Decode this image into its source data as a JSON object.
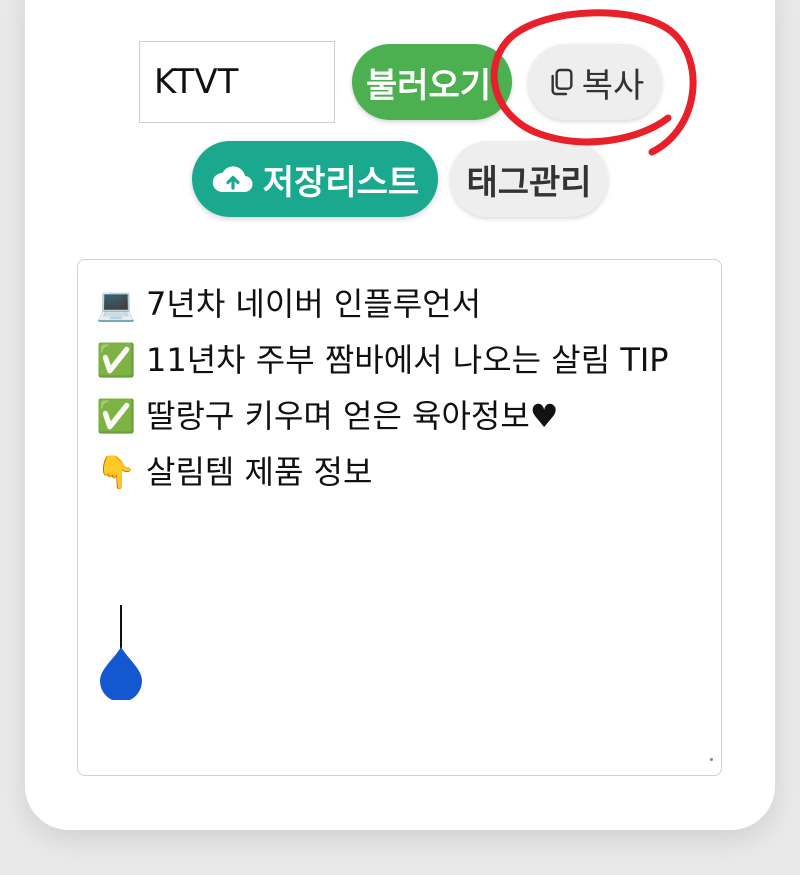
{
  "code_input": {
    "value": "KTVT"
  },
  "buttons": {
    "load_label": "불러오기",
    "copy_label": "복사",
    "save_list_label": "저장리스트",
    "tag_manage_label": "태그관리"
  },
  "bio": {
    "lines": [
      "💻 7년차 네이버 인플루언서",
      "✅ 11년차 주부 짬바에서 나오는 살림 TIP",
      "✅ 딸랑구 키우며 얻은 육아정보♥",
      "👇 살림템 제품 정보"
    ]
  },
  "colors": {
    "load_green": "#4caf50",
    "save_teal": "#1aa88f",
    "annotation_red": "#e8202a",
    "handle_blue": "#1358d0"
  },
  "icons": {
    "copy": "copy-icon",
    "cloud_upload": "cloud-upload-icon",
    "text_handle": "text-cursor-handle-icon"
  }
}
